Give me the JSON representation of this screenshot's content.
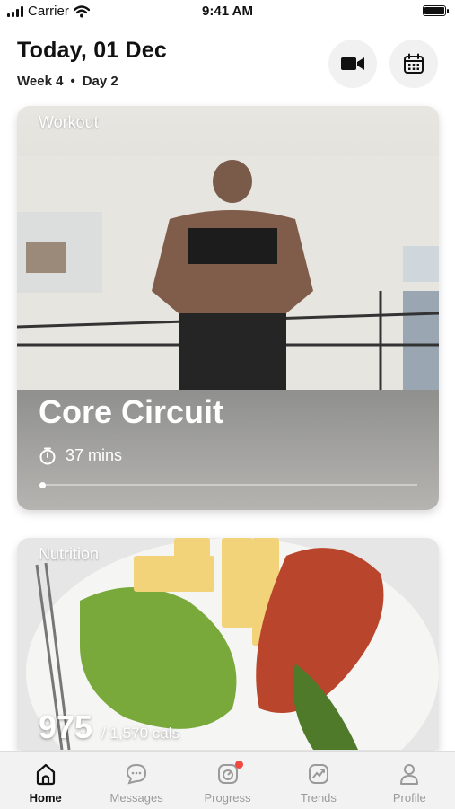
{
  "status_bar": {
    "carrier": "Carrier",
    "time": "9:41 AM"
  },
  "header": {
    "date": "Today, 01 Dec",
    "week": "Week 4",
    "separator": "•",
    "day": "Day 2"
  },
  "header_actions": [
    "video-camera-icon",
    "calendar-icon"
  ],
  "workout": {
    "label": "Workout",
    "title": "Core Circuit",
    "duration": "37 mins",
    "progress": 0.0
  },
  "nutrition": {
    "label": "Nutrition",
    "consumed": "975",
    "target": "/ 1,570 cals"
  },
  "tabbar": [
    {
      "label": "Home",
      "icon": "home-icon",
      "active": true
    },
    {
      "label": "Messages",
      "icon": "messages-icon",
      "active": false
    },
    {
      "label": "Progress",
      "icon": "progress-icon",
      "active": false,
      "badge": true
    },
    {
      "label": "Trends",
      "icon": "trends-icon",
      "active": false
    },
    {
      "label": "Profile",
      "icon": "profile-icon",
      "active": false
    }
  ],
  "colors": {
    "badge": "#f04a40",
    "header_button_bg": "#f1f1f2",
    "tab_active": "#111111",
    "tab_inactive": "#9a9a9a"
  }
}
